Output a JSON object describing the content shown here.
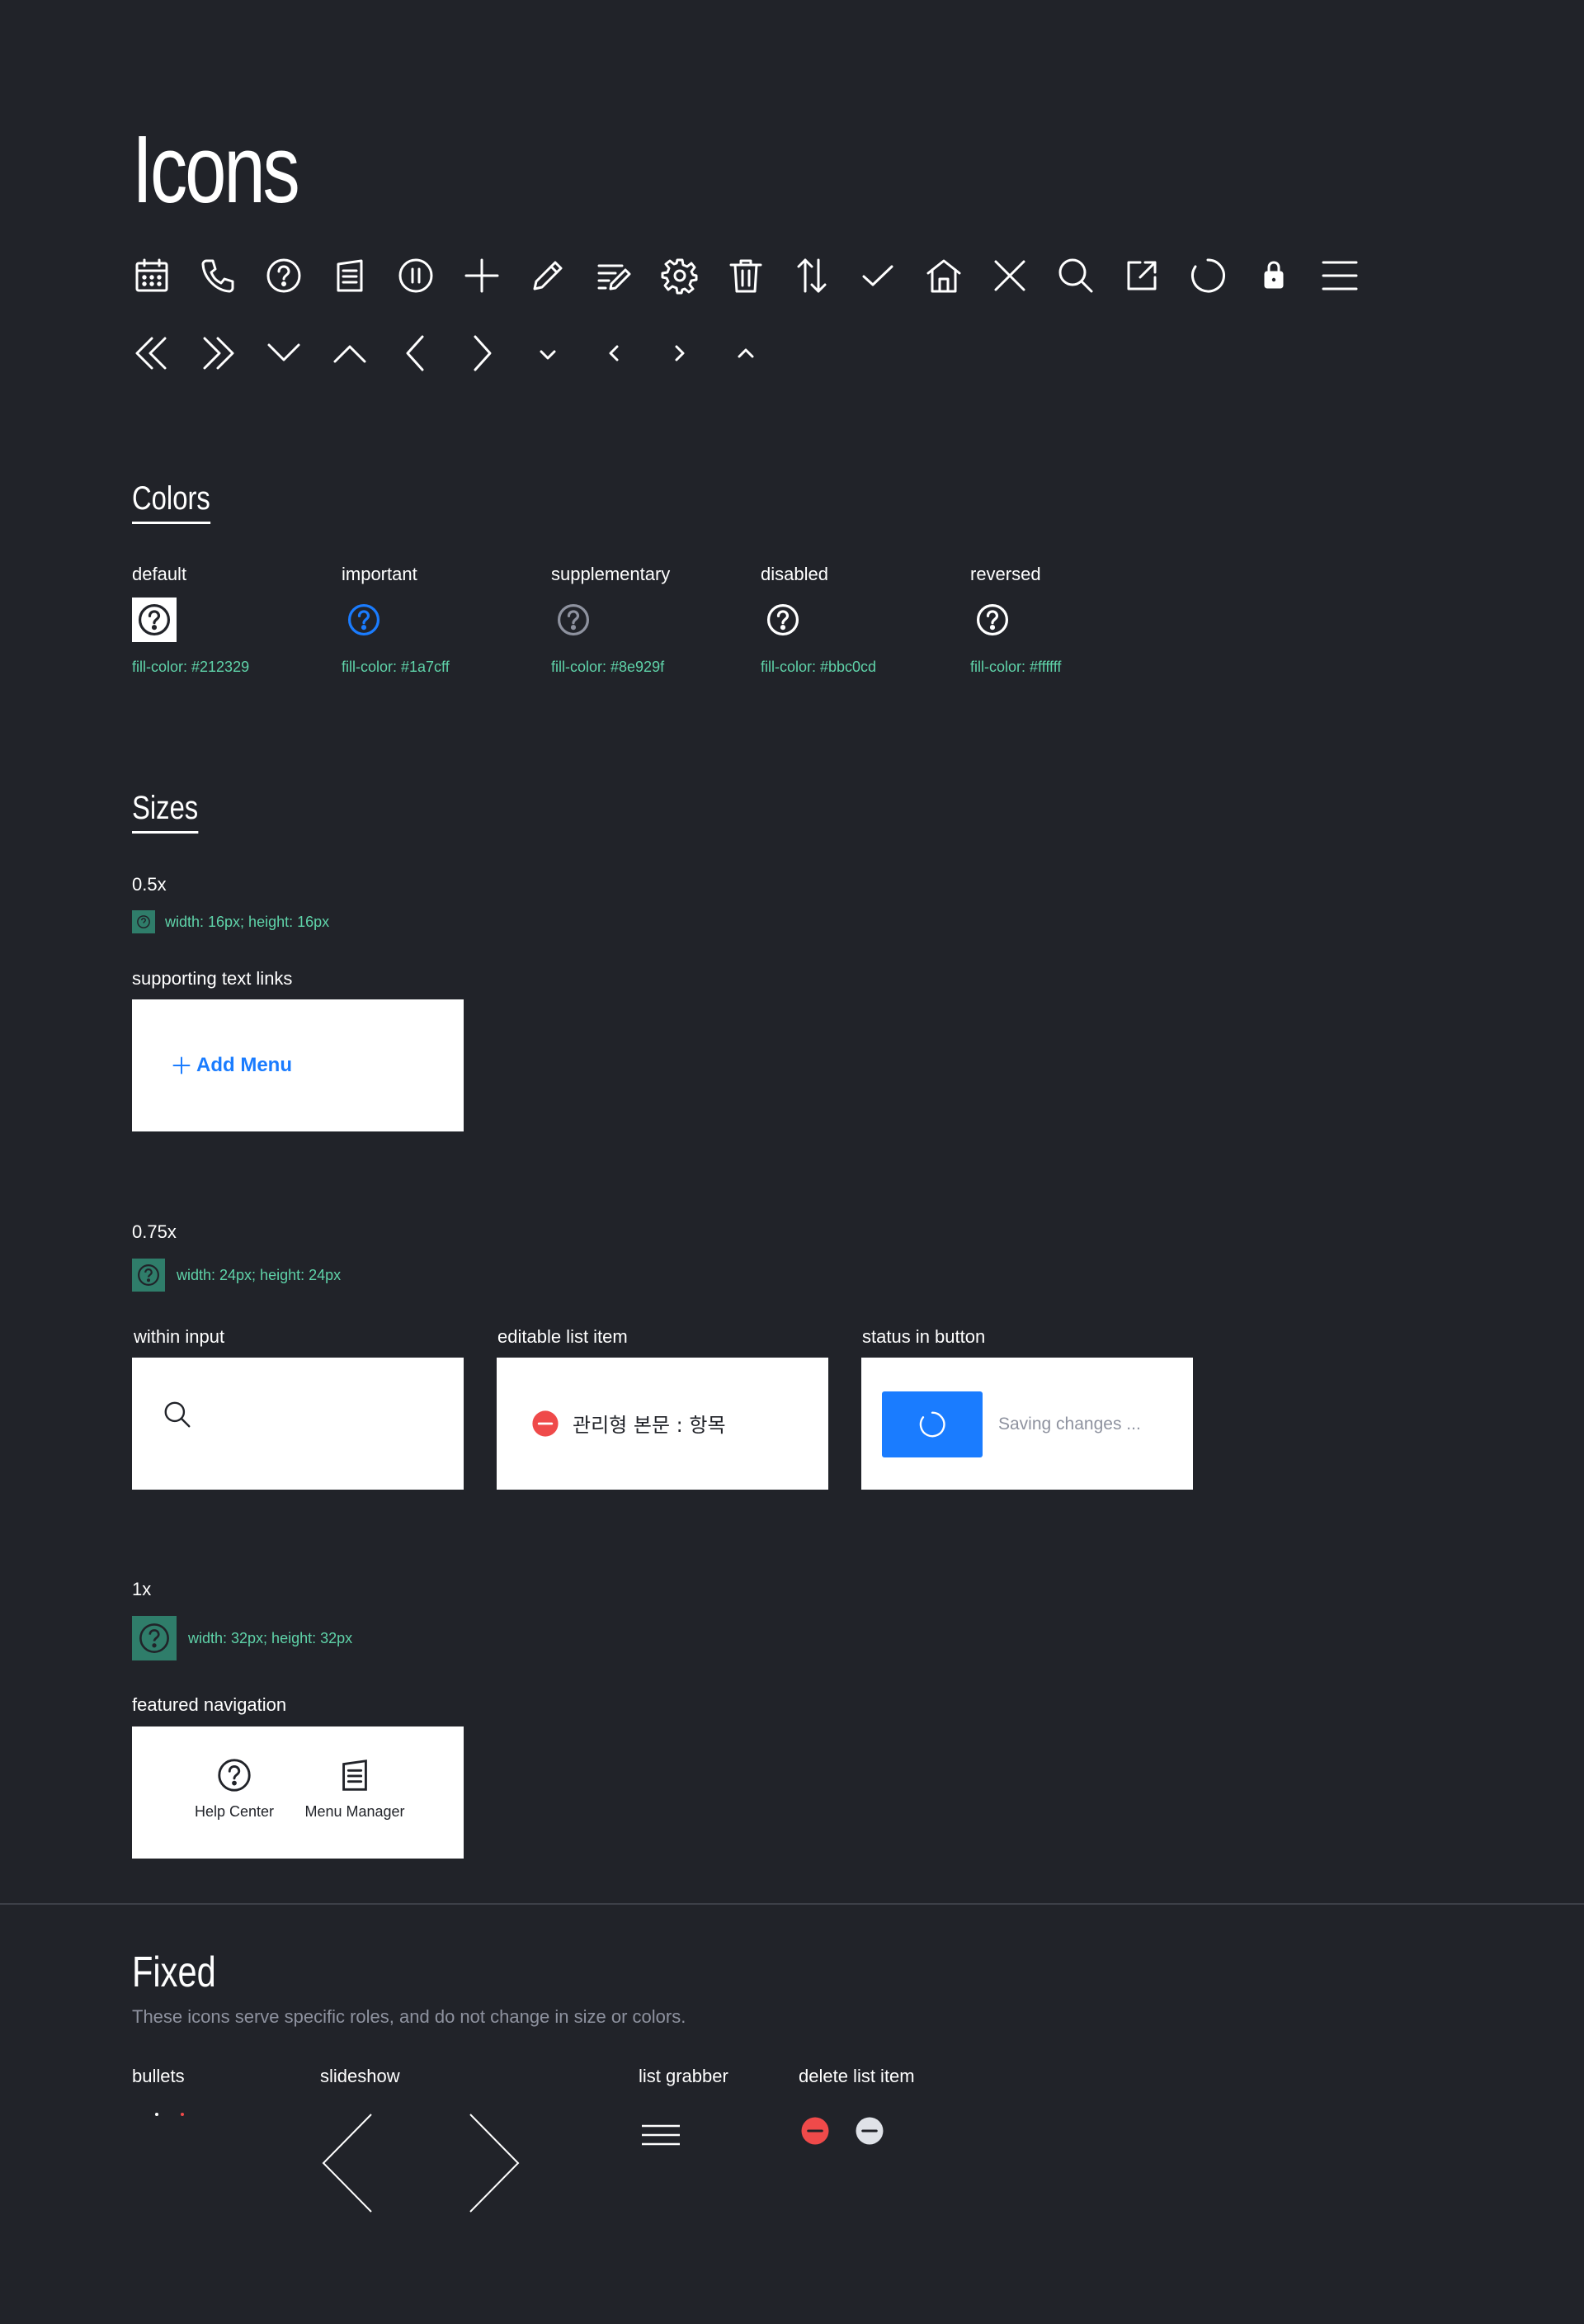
{
  "header": {
    "title": "Icons"
  },
  "icon_row_1": [
    "calendar-icon",
    "phone-icon",
    "help-icon",
    "document-icon",
    "pause-icon",
    "plus-icon",
    "pencil-icon",
    "edit-list-icon",
    "gear-icon",
    "trash-icon",
    "sort-icon",
    "check-icon",
    "home-icon",
    "close-icon",
    "search-icon",
    "external-link-icon",
    "loading-icon",
    "lock-icon",
    "menu-icon"
  ],
  "icon_row_2": [
    "double-chevron-left-icon",
    "double-chevron-right-icon",
    "chevron-down-icon",
    "chevron-up-icon",
    "chevron-left-icon",
    "chevron-right-icon",
    "chevron-down-small-icon",
    "chevron-left-small-icon",
    "chevron-right-small-icon",
    "chevron-up-small-icon"
  ],
  "colors": {
    "heading": "Colors",
    "items": [
      {
        "name": "default",
        "fill": "fill-color: #212329",
        "hex": "#212329"
      },
      {
        "name": "important",
        "fill": "fill-color: #1a7cff",
        "hex": "#1a7cff"
      },
      {
        "name": "supplementary",
        "fill": "fill-color: #8e929f",
        "hex": "#8e929f"
      },
      {
        "name": "disabled",
        "fill": "fill-color: #bbc0cd",
        "hex": "#bbc0cd"
      },
      {
        "name": "reversed",
        "fill": "fill-color: #ffffff",
        "hex": "#ffffff"
      }
    ]
  },
  "sizes": {
    "heading": "Sizes",
    "half": {
      "label": "0.5x",
      "spec": "width: 16px; height: 16px",
      "example_label": "supporting text links",
      "add_menu": "Add Menu"
    },
    "three_quarter": {
      "label": "0.75x",
      "spec": "width: 24px; height: 24px",
      "within_input": "within input",
      "editable_list_item": "editable list item",
      "editable_text": "관리형 본문 : 항목",
      "status_in_button": "status in button",
      "saving_text": "Saving changes ..."
    },
    "one": {
      "label": "1x",
      "spec": "width: 32px; height: 32px",
      "featured_navigation": "featured navigation",
      "nav_help": "Help Center",
      "nav_menu": "Menu Manager"
    }
  },
  "fixed": {
    "heading": "Fixed",
    "description": "These icons serve specific roles, and do not change in size or colors.",
    "bullets": "bullets",
    "slideshow": "slideshow",
    "list_grabber": "list grabber",
    "delete_list_item": "delete list item"
  },
  "accent_colors": {
    "blue": "#1a7cff",
    "red": "#ef4a4a",
    "mint": "#5fd3a9",
    "teal_square": "#2f7d6a"
  }
}
